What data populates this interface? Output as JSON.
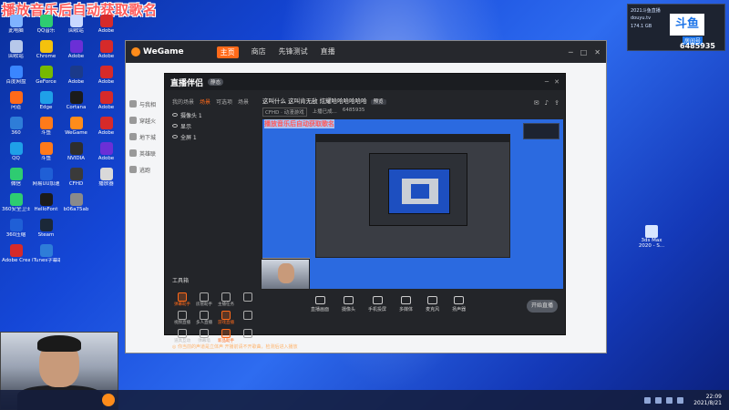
{
  "overlay": {
    "title": "播放音乐后自动获取歌名"
  },
  "desktop_icons": [
    {
      "label": "此电脑",
      "color": "#7fb3ff"
    },
    {
      "label": "QQ音乐",
      "color": "#2ecc71"
    },
    {
      "label": "回收站",
      "color": "#c8d8ff"
    },
    {
      "label": "Adobe",
      "color": "#d62a2a"
    },
    {
      "label": "回收站",
      "color": "#b7c8ea"
    },
    {
      "label": "Chrome",
      "color": "#f4c20d"
    },
    {
      "label": "Adobe",
      "color": "#6b2fd6"
    },
    {
      "label": "Adobe",
      "color": "#d62a2a"
    },
    {
      "label": "百度网盘",
      "color": "#3a86ff"
    },
    {
      "label": "GeForce",
      "color": "#76b900"
    },
    {
      "label": "Adobe",
      "color": "#1b3a8a"
    },
    {
      "label": "Adobe",
      "color": "#d62a2a"
    },
    {
      "label": "问道",
      "color": "#ff6a1a"
    },
    {
      "label": "Edge",
      "color": "#1fa0e8"
    },
    {
      "label": "Cortana",
      "color": "#1b1b1b"
    },
    {
      "label": "Adobe",
      "color": "#d62a2a"
    },
    {
      "label": "360",
      "color": "#2e7dd8"
    },
    {
      "label": "斗鱼",
      "color": "#ff7a1a"
    },
    {
      "label": "WeGame",
      "color": "#ff8c1a"
    },
    {
      "label": "Adobe",
      "color": "#d62a2a"
    },
    {
      "label": "QQ",
      "color": "#1fa0e8"
    },
    {
      "label": "斗鱼",
      "color": "#ff7a1a"
    },
    {
      "label": "NVIDIA",
      "color": "#2e2e2e"
    },
    {
      "label": "Adobe",
      "color": "#6b2fd6"
    },
    {
      "label": "微信",
      "color": "#2ecc71"
    },
    {
      "label": "网易UU加速",
      "color": "#1f5fd6"
    },
    {
      "label": "CFHD",
      "color": "#3a3a3a"
    },
    {
      "label": "播放器",
      "color": "#d9d9d9"
    },
    {
      "label": "360安全卫士",
      "color": "#2ecc71"
    },
    {
      "label": "HelloFont",
      "color": "#1b1b1b"
    },
    {
      "label": "b06a75ab",
      "color": "#8a8a8a"
    },
    {
      "label": "",
      "color": "rgba(0,0,0,0)"
    },
    {
      "label": "360压缩",
      "color": "#1f5fd6"
    },
    {
      "label": "Steam",
      "color": "#1b2838"
    },
    {
      "label": "",
      "color": "rgba(0,0,0,0)"
    },
    {
      "label": "",
      "color": "rgba(0,0,0,0)"
    },
    {
      "label": "Adobe Creati...",
      "color": "#d62a2a"
    },
    {
      "label": "iTunes字幕助手",
      "color": "#2e7dd8"
    },
    {
      "label": "",
      "color": "rgba(0,0,0,0)"
    },
    {
      "label": "",
      "color": "rgba(0,0,0,0)"
    }
  ],
  "right_desktop_icon": {
    "label": "3ds Max 2020 - S..."
  },
  "stream_badge": {
    "lines": [
      "2021斗鱼直播",
      "douyu.tv",
      "174.1 GB"
    ],
    "logo": "斗鱼",
    "room_label": "房间号",
    "room_id": "6485935"
  },
  "wegame": {
    "brand": "WeGame",
    "nav": [
      "主页",
      "商店",
      "先锋测试",
      "直播"
    ],
    "sidebar": [
      "与我相",
      "穿越火",
      "地下城",
      "英雄联",
      "逃跑"
    ]
  },
  "zhibo": {
    "brand": "直播伴侣",
    "tag": "静态",
    "tabs": [
      "我的场景",
      "场景",
      "可选项",
      "场景"
    ],
    "scenes": [
      "摄像头 1",
      "显示",
      "全屏 1"
    ],
    "title": "这叫什么  这叫肯无敌 炫耀哈哈哈哈哈哈",
    "rec_tag": "预览",
    "meta": {
      "category": "CFHD · 动漫游戏",
      "status": "上播已成...",
      "id": "6485935"
    },
    "preview_title": "播放音乐后自动获取歌名",
    "tools_title": "工具箱",
    "tools": [
      {
        "label": "弹幕助手",
        "hl": true
      },
      {
        "label": "房管助手",
        "hl": false
      },
      {
        "label": "主播任务",
        "hl": false
      },
      {
        "label": "",
        "hl": false
      },
      {
        "label": "视频直播",
        "hl": false
      },
      {
        "label": "多人直播",
        "hl": false
      },
      {
        "label": "游戏直播",
        "hl": true
      },
      {
        "label": "",
        "hl": false
      },
      {
        "label": "道具互动",
        "hl": false
      },
      {
        "label": "弹幕墙",
        "hl": false
      },
      {
        "label": "新品助手",
        "hl": true
      },
      {
        "label": "",
        "hl": false
      }
    ],
    "notice": "◎ 你当前的声道是立体声 开播前请不开歌曲，检测后进入播放",
    "bottom": [
      "直播画面",
      "摄像头",
      "手机投屏",
      "多媒体",
      "麦克风",
      "扬声器"
    ],
    "start_label": "开始直播"
  },
  "taskbar": {
    "time": "22:09",
    "date": "2021/8/21"
  }
}
